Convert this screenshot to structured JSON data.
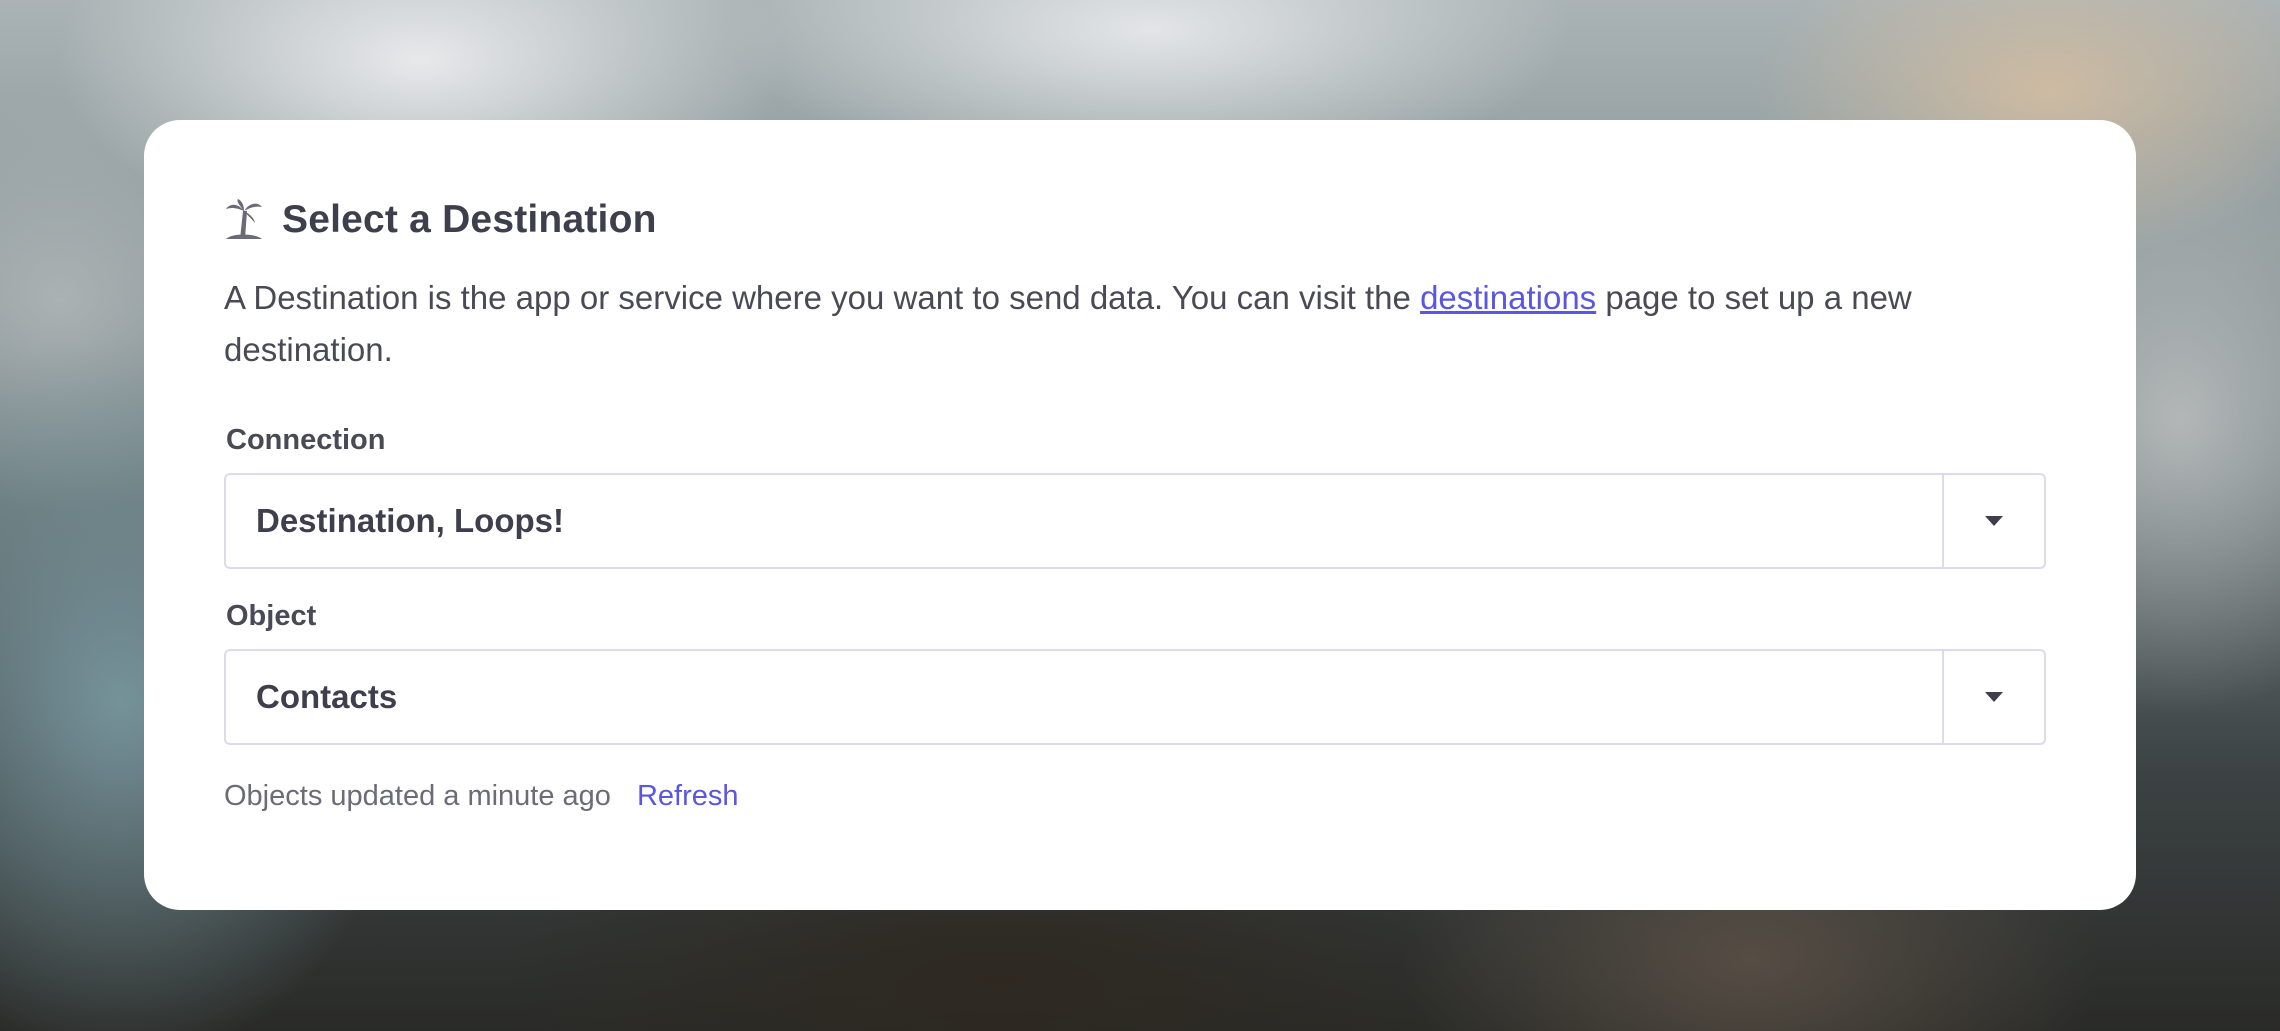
{
  "panel": {
    "title": "Select a Destination",
    "title_icon": "palm-tree-icon",
    "description_before": "A Destination is the app or service where you want to send data. You can visit the ",
    "description_link": "destinations",
    "description_after": " page to set up a new destination."
  },
  "connection": {
    "label": "Connection",
    "selected": "Destination, Loops!",
    "toggle_icon": "caret-down-icon"
  },
  "object": {
    "label": "Object",
    "selected": "Contacts",
    "toggle_icon": "caret-down-icon"
  },
  "status": {
    "text": "Objects updated a minute ago",
    "refresh_label": "Refresh"
  },
  "colors": {
    "accent": "#5a56e0",
    "text": "#3f3e4c",
    "border": "#dcdbe9"
  }
}
